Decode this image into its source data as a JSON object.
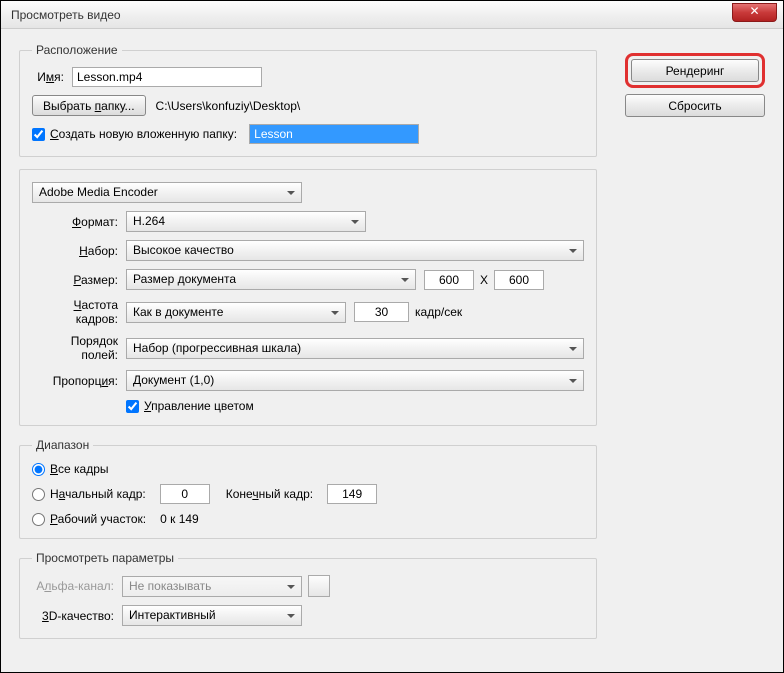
{
  "window": {
    "title": "Просмотреть видео",
    "close": "✕"
  },
  "sidebar": {
    "render": "Рендеринг",
    "reset": "Сбросить"
  },
  "location": {
    "legend": "Расположение",
    "name_label_pre": "И",
    "name_label_u": "м",
    "name_label_post": "я:",
    "name_value": "Lesson.mp4",
    "choose_folder_pre": "Выбрать ",
    "choose_folder_u": "п",
    "choose_folder_post": "апку...",
    "path": "C:\\Users\\konfuziy\\Desktop\\",
    "subfolder_pre": "",
    "subfolder_u": "С",
    "subfolder_post": "оздать новую вложенную папку:",
    "subfolder_value": "Lesson"
  },
  "encoder": {
    "engine": "Adobe Media Encoder",
    "format_label_pre": "",
    "format_label_u": "Ф",
    "format_label_post": "ормат:",
    "format_value": "H.264",
    "preset_label_pre": "",
    "preset_label_u": "Н",
    "preset_label_post": "абор:",
    "preset_value": "Высокое качество",
    "size_label_pre": "",
    "size_label_u": "Р",
    "size_label_post": "азмер:",
    "size_value": "Размер документа",
    "size_w": "600",
    "size_x": "X",
    "size_h": "600",
    "fps_label_pre": "",
    "fps_label_u": "Ч",
    "fps_label_post": "астота кадров:",
    "fps_value": "Как в документе",
    "fps_num": "30",
    "fps_unit": "кадр/сек",
    "order_label": "Порядок полей:",
    "order_value": "Набор (прогрессивная шкала)",
    "aspect_label_pre": "Пропорц",
    "aspect_label_u": "и",
    "aspect_label_post": "я:",
    "aspect_value": "Документ (1,0)",
    "colormgmt_pre": "",
    "colormgmt_u": "У",
    "colormgmt_post": "правление цветом"
  },
  "range": {
    "legend": "Диапазон",
    "all_pre": "",
    "all_u": "В",
    "all_post": "се кадры",
    "start_pre": "Н",
    "start_u": "а",
    "start_post": "чальный кадр:",
    "start_val": "0",
    "end_pre": "Коне",
    "end_u": "ч",
    "end_post": "ный кадр:",
    "end_val": "149",
    "work_pre": "",
    "work_u": "Р",
    "work_post": "абочий участок:",
    "work_range": "0 к 149"
  },
  "preview": {
    "legend": "Просмотреть параметры",
    "alpha_label_pre": "А",
    "alpha_label_u": "л",
    "alpha_label_post": "ьфа-канал:",
    "alpha_value": "Не показывать",
    "q3d_label_pre": "",
    "q3d_label_u": "3",
    "q3d_label_post": "D-качество:",
    "q3d_value": "Интерактивный"
  }
}
